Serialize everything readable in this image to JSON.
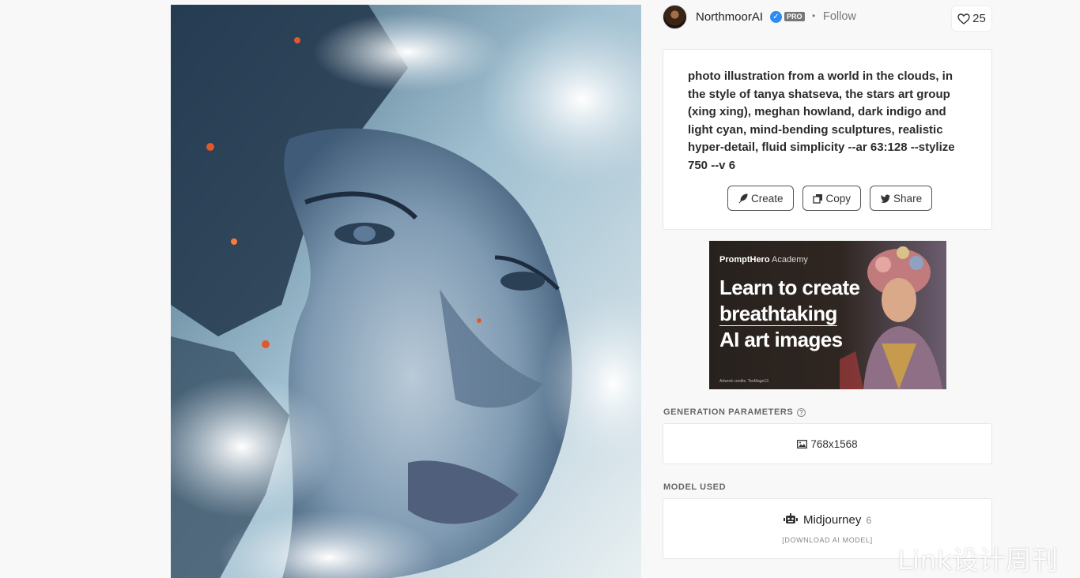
{
  "author": {
    "name": "NorthmoorAI",
    "badge": "PRO",
    "separator": "•",
    "follow_label": "Follow"
  },
  "likes": {
    "count": "25",
    "icon": "heart-icon"
  },
  "prompt": {
    "text": "photo illustration from a world in the clouds, in the style of tanya shatseva, the stars art group (xing xing), meghan howland, dark indigo and light cyan, mind-bending sculptures, realistic hyper-detail, fluid simplicity --ar 63:128 --stylize 750 --v 6",
    "actions": {
      "create_label": "Create",
      "copy_label": "Copy",
      "share_label": "Share"
    }
  },
  "banner": {
    "brand_bold": "PromptHero",
    "brand_light": "Academy",
    "line1": "Learn to create",
    "line2": "breathtaking",
    "line3": "AI art images",
    "credit": "Artwork credits: TeeMage13"
  },
  "generation": {
    "label": "GENERATION PARAMETERS",
    "help_icon": "?",
    "dimensions": "768x1568"
  },
  "model": {
    "label": "MODEL USED",
    "name": "Midjourney",
    "version": "6",
    "download_label": "[DOWNLOAD AI MODEL]"
  },
  "watermark": "Link设计周刊",
  "colors": {
    "accent_blue": "#2d8cf0",
    "card_border": "#e6e6e6",
    "page_bg": "#f8f8f8"
  }
}
